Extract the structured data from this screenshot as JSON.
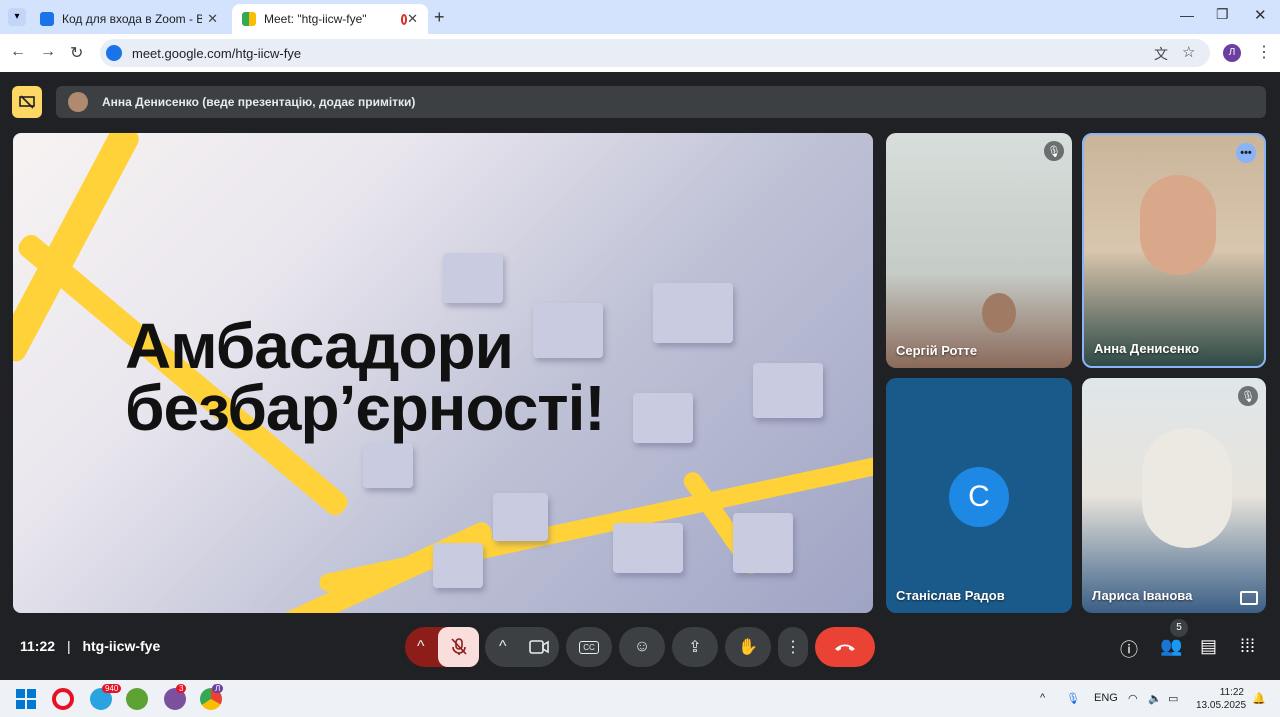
{
  "browser": {
    "tabs": [
      {
        "label": "Код для входа в Zoom - Вхідн",
        "active": false
      },
      {
        "label": "Meet: \"htg-iicw-fye\"",
        "active": true
      }
    ],
    "url": "meet.google.com/htg-iicw-fye",
    "profile_initial": "Л"
  },
  "meet": {
    "presenter_banner": "Анна Денисенко (веде презентацію, додає примітки)",
    "slide_title_line1": "Амбасадори",
    "slide_title_line2": "безбар’єрності!",
    "participants": [
      {
        "name": "Сергій Ротте",
        "muted": true
      },
      {
        "name": "Анна Денисенко",
        "muted": false
      },
      {
        "name": "Станіслав Радов",
        "avatar_letter": "С"
      },
      {
        "name": "Лариса Іванова",
        "muted": true
      }
    ],
    "time": "11:22",
    "separator": "|",
    "meeting_code": "htg-iicw-fye",
    "participant_count": "5"
  },
  "taskbar": {
    "telegram_badge": "940",
    "viber_badge": "3",
    "chrome_badge": "Л",
    "lang": "ENG",
    "clock_time": "11:22",
    "clock_date": "13.05.2025"
  },
  "colors": {
    "end_call": "#ea4335",
    "mic_off": "#f9dedc",
    "accent": "#8ab4f8"
  }
}
